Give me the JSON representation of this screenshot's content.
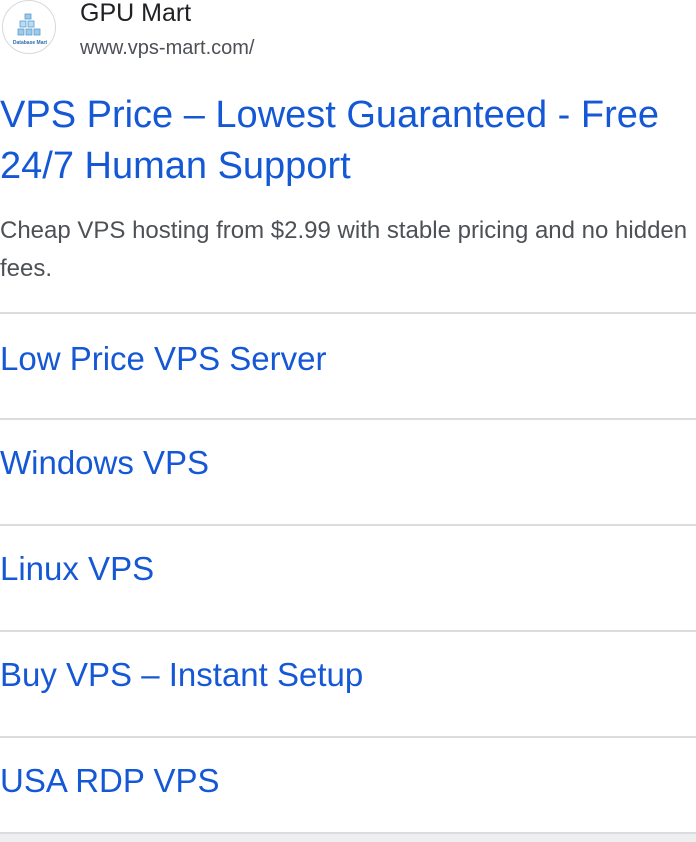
{
  "advertiser": {
    "name": "GPU Mart",
    "display_url": "www.vps-mart.com/",
    "logo_text": "Database Mart",
    "logo_icon": "database-mart-logo"
  },
  "ad": {
    "headline": "VPS Price – Lowest Guaranteed - Free 24/7 Human Support",
    "description": "Cheap VPS hosting from $2.99 with stable pricing and no hidden fees."
  },
  "sitelinks": [
    {
      "label": "Low Price VPS Server"
    },
    {
      "label": "Windows VPS"
    },
    {
      "label": "Linux VPS"
    },
    {
      "label": "Buy VPS – Instant Setup"
    },
    {
      "label": "USA RDP VPS"
    }
  ],
  "colors": {
    "link": "#1558d6",
    "text_primary": "#202124",
    "text_secondary": "#4d5156",
    "divider": "#dadce0",
    "logo_accent": "#3b82c4"
  }
}
